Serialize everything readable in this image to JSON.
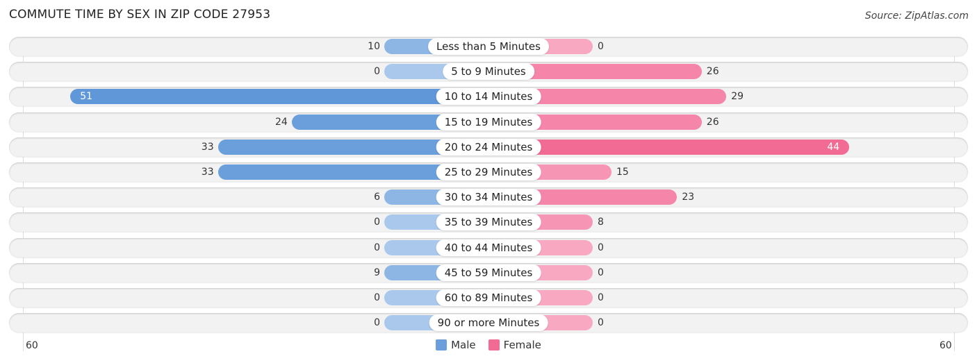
{
  "title": "COMMUTE TIME BY SEX IN ZIP CODE 27953",
  "source": "Source: ZipAtlas.com",
  "colors": {
    "male": "#6a9fdb",
    "female": "#f26b95",
    "male_light": "#a9c8ec",
    "female_light": "#f8a8c1"
  },
  "chart_data": {
    "type": "bar",
    "orientation": "horizontal-diverging",
    "title": "COMMUTE TIME BY SEX IN ZIP CODE 27953",
    "categories": [
      "Less than 5 Minutes",
      "5 to 9 Minutes",
      "10 to 14 Minutes",
      "15 to 19 Minutes",
      "20 to 24 Minutes",
      "25 to 29 Minutes",
      "30 to 34 Minutes",
      "35 to 39 Minutes",
      "40 to 44 Minutes",
      "45 to 59 Minutes",
      "60 to 89 Minutes",
      "90 or more Minutes"
    ],
    "series": [
      {
        "name": "Male",
        "values": [
          10,
          0,
          51,
          24,
          33,
          33,
          6,
          0,
          0,
          9,
          0,
          0
        ]
      },
      {
        "name": "Female",
        "values": [
          0,
          26,
          29,
          26,
          44,
          15,
          23,
          8,
          0,
          0,
          0,
          0
        ]
      }
    ],
    "xlim": [
      -60,
      60
    ],
    "axis_labels": {
      "left": "60",
      "right": "60"
    },
    "legend": [
      "Male",
      "Female"
    ],
    "legend_position": "bottom-center",
    "grid": false
  }
}
